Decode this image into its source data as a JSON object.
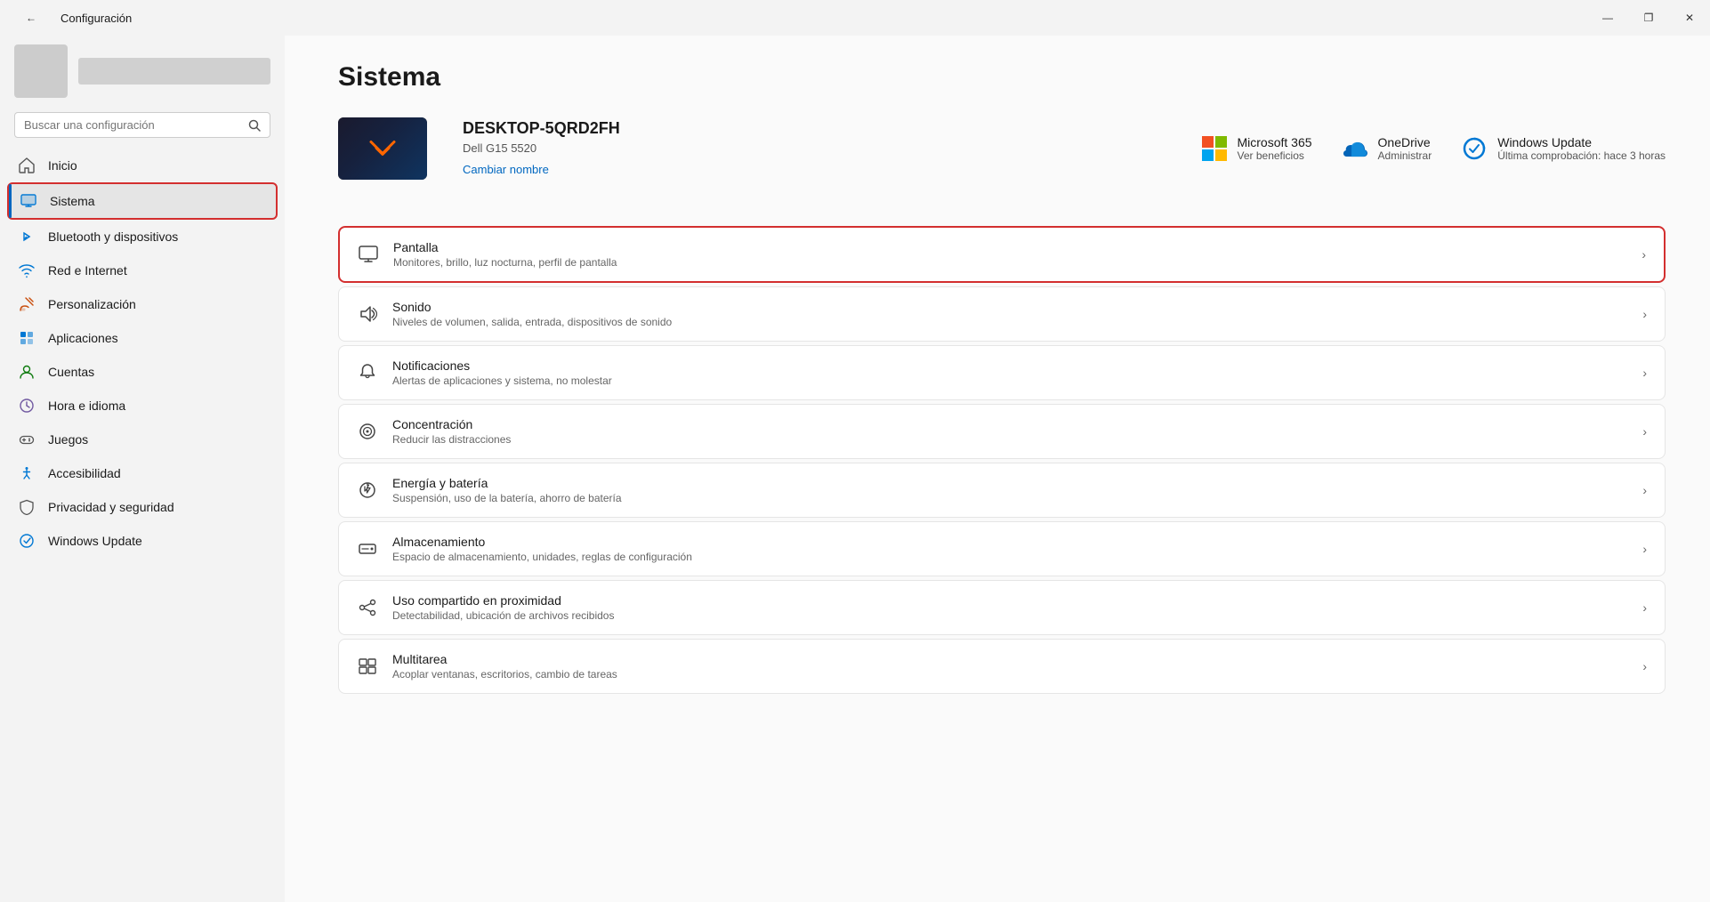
{
  "titlebar": {
    "back_label": "←",
    "title": "Configuración",
    "minimize_label": "—",
    "maximize_label": "❐",
    "close_label": "✕"
  },
  "sidebar": {
    "search_placeholder": "Buscar una configuración",
    "nav_items": [
      {
        "id": "inicio",
        "label": "Inicio",
        "icon": "home"
      },
      {
        "id": "sistema",
        "label": "Sistema",
        "icon": "sistema",
        "active": true
      },
      {
        "id": "bluetooth",
        "label": "Bluetooth y dispositivos",
        "icon": "bluetooth"
      },
      {
        "id": "red",
        "label": "Red e Internet",
        "icon": "red"
      },
      {
        "id": "personalizacion",
        "label": "Personalización",
        "icon": "personalizacion"
      },
      {
        "id": "aplicaciones",
        "label": "Aplicaciones",
        "icon": "aplicaciones"
      },
      {
        "id": "cuentas",
        "label": "Cuentas",
        "icon": "cuentas"
      },
      {
        "id": "hora",
        "label": "Hora e idioma",
        "icon": "hora"
      },
      {
        "id": "juegos",
        "label": "Juegos",
        "icon": "juegos"
      },
      {
        "id": "accesibilidad",
        "label": "Accesibilidad",
        "icon": "accesibilidad"
      },
      {
        "id": "privacidad",
        "label": "Privacidad y seguridad",
        "icon": "privacidad"
      },
      {
        "id": "windowsupdate",
        "label": "Windows Update",
        "icon": "windowsupdate"
      }
    ]
  },
  "main": {
    "page_title": "Sistema",
    "device": {
      "name": "DESKTOP-5QRD2FH",
      "model": "Dell G15 5520",
      "rename_label": "Cambiar nombre"
    },
    "system_links": [
      {
        "id": "ms365",
        "title": "Microsoft 365",
        "subtitle": "Ver beneficios"
      },
      {
        "id": "onedrive",
        "title": "OneDrive",
        "subtitle": "Administrar"
      },
      {
        "id": "winupdate",
        "title": "Windows Update",
        "subtitle": "Última comprobación: hace 3 horas"
      }
    ],
    "settings": [
      {
        "id": "pantalla",
        "title": "Pantalla",
        "desc": "Monitores, brillo, luz nocturna, perfil de pantalla",
        "highlighted": true
      },
      {
        "id": "sonido",
        "title": "Sonido",
        "desc": "Niveles de volumen, salida, entrada, dispositivos de sonido"
      },
      {
        "id": "notificaciones",
        "title": "Notificaciones",
        "desc": "Alertas de aplicaciones y sistema, no molestar"
      },
      {
        "id": "concentracion",
        "title": "Concentración",
        "desc": "Reducir las distracciones"
      },
      {
        "id": "energia",
        "title": "Energía y batería",
        "desc": "Suspensión, uso de la batería, ahorro de batería"
      },
      {
        "id": "almacenamiento",
        "title": "Almacenamiento",
        "desc": "Espacio de almacenamiento, unidades, reglas de configuración"
      },
      {
        "id": "compartido",
        "title": "Uso compartido en proximidad",
        "desc": "Detectabilidad, ubicación de archivos recibidos"
      },
      {
        "id": "multitarea",
        "title": "Multitarea",
        "desc": "Acoplar ventanas, escritorios, cambio de tareas"
      }
    ]
  }
}
